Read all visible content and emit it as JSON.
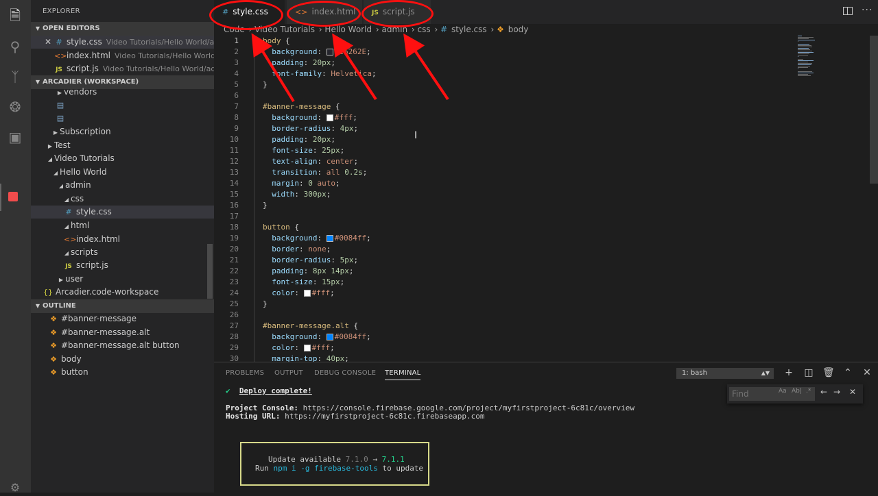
{
  "sidebar": {
    "title": "EXPLORER",
    "open_editors": {
      "header": "OPEN EDITORS",
      "items": [
        {
          "name": "style.css",
          "path": "Video Tutorials/Hello World/ad...",
          "icon": "css-file-icon"
        },
        {
          "name": "index.html",
          "path": "Video Tutorials/Hello World/a...",
          "icon": "html-file-icon"
        },
        {
          "name": "script.js",
          "path": "Video Tutorials/Hello World/adm...",
          "icon": "js-file-icon"
        }
      ]
    },
    "workspace": {
      "header": "ARCADIER (WORKSPACE)",
      "tree": [
        {
          "label": "vendors"
        },
        {
          "label": ""
        },
        {
          "label": ""
        },
        {
          "label": "Subscription"
        },
        {
          "label": "Test"
        },
        {
          "label": "Video Tutorials"
        },
        {
          "label": "Hello World"
        },
        {
          "label": "admin"
        },
        {
          "label": "css"
        },
        {
          "label": "style.css"
        },
        {
          "label": "html"
        },
        {
          "label": "index.html"
        },
        {
          "label": "scripts"
        },
        {
          "label": "script.js"
        },
        {
          "label": "user"
        },
        {
          "label": "Arcadier.code-workspace"
        }
      ]
    },
    "outline": {
      "header": "OUTLINE",
      "items": [
        "#banner-message",
        "#banner-message.alt",
        "#banner-message.alt button",
        "body",
        "button"
      ]
    }
  },
  "tabs": [
    {
      "label": "style.css",
      "icon_text": "#"
    },
    {
      "label": "index.html",
      "icon_text": "<>"
    },
    {
      "label": "script.js",
      "icon_text": "JS"
    }
  ],
  "breadcrumb": [
    "Code",
    "Video Tutorials",
    "Hello World",
    "admin",
    "css",
    "style.css",
    "body"
  ],
  "editor": {
    "lines": [
      [
        [
          "sel",
          "body"
        ],
        [
          "pun",
          " {"
        ]
      ],
      [
        [
          "pun",
          "  "
        ],
        [
          "prop",
          "background"
        ],
        [
          "pun",
          ": "
        ],
        [
          "swatch",
          "#26262E"
        ],
        [
          "val",
          "#26262E"
        ],
        [
          "pun",
          ";"
        ]
      ],
      [
        [
          "pun",
          "  "
        ],
        [
          "prop",
          "padding"
        ],
        [
          "pun",
          ": "
        ],
        [
          "num",
          "20px"
        ],
        [
          "pun",
          ";"
        ]
      ],
      [
        [
          "pun",
          "  "
        ],
        [
          "prop",
          "font-family"
        ],
        [
          "pun",
          ": "
        ],
        [
          "val",
          "Helvetica"
        ],
        [
          "pun",
          ";"
        ]
      ],
      [
        [
          "pun",
          "}"
        ]
      ],
      [],
      [
        [
          "sel",
          "#banner-message"
        ],
        [
          "pun",
          " {"
        ]
      ],
      [
        [
          "pun",
          "  "
        ],
        [
          "prop",
          "background"
        ],
        [
          "pun",
          ": "
        ],
        [
          "swatch",
          "#ffffff"
        ],
        [
          "val",
          "#fff"
        ],
        [
          "pun",
          ";"
        ]
      ],
      [
        [
          "pun",
          "  "
        ],
        [
          "prop",
          "border-radius"
        ],
        [
          "pun",
          ": "
        ],
        [
          "num",
          "4px"
        ],
        [
          "pun",
          ";"
        ]
      ],
      [
        [
          "pun",
          "  "
        ],
        [
          "prop",
          "padding"
        ],
        [
          "pun",
          ": "
        ],
        [
          "num",
          "20px"
        ],
        [
          "pun",
          ";"
        ]
      ],
      [
        [
          "pun",
          "  "
        ],
        [
          "prop",
          "font-size"
        ],
        [
          "pun",
          ": "
        ],
        [
          "num",
          "25px"
        ],
        [
          "pun",
          ";"
        ]
      ],
      [
        [
          "pun",
          "  "
        ],
        [
          "prop",
          "text-align"
        ],
        [
          "pun",
          ": "
        ],
        [
          "val",
          "center"
        ],
        [
          "pun",
          ";"
        ]
      ],
      [
        [
          "pun",
          "  "
        ],
        [
          "prop",
          "transition"
        ],
        [
          "pun",
          ": "
        ],
        [
          "val",
          "all "
        ],
        [
          "num",
          "0.2s"
        ],
        [
          "pun",
          ";"
        ]
      ],
      [
        [
          "pun",
          "  "
        ],
        [
          "prop",
          "margin"
        ],
        [
          "pun",
          ": "
        ],
        [
          "num",
          "0 "
        ],
        [
          "val",
          "auto"
        ],
        [
          "pun",
          ";"
        ]
      ],
      [
        [
          "pun",
          "  "
        ],
        [
          "prop",
          "width"
        ],
        [
          "pun",
          ": "
        ],
        [
          "num",
          "300px"
        ],
        [
          "pun",
          ";"
        ]
      ],
      [
        [
          "pun",
          "}"
        ]
      ],
      [],
      [
        [
          "sel",
          "button"
        ],
        [
          "pun",
          " {"
        ]
      ],
      [
        [
          "pun",
          "  "
        ],
        [
          "prop",
          "background"
        ],
        [
          "pun",
          ": "
        ],
        [
          "swatch",
          "#0084ff"
        ],
        [
          "val",
          "#0084ff"
        ],
        [
          "pun",
          ";"
        ]
      ],
      [
        [
          "pun",
          "  "
        ],
        [
          "prop",
          "border"
        ],
        [
          "pun",
          ": "
        ],
        [
          "val",
          "none"
        ],
        [
          "pun",
          ";"
        ]
      ],
      [
        [
          "pun",
          "  "
        ],
        [
          "prop",
          "border-radius"
        ],
        [
          "pun",
          ": "
        ],
        [
          "num",
          "5px"
        ],
        [
          "pun",
          ";"
        ]
      ],
      [
        [
          "pun",
          "  "
        ],
        [
          "prop",
          "padding"
        ],
        [
          "pun",
          ": "
        ],
        [
          "num",
          "8px 14px"
        ],
        [
          "pun",
          ";"
        ]
      ],
      [
        [
          "pun",
          "  "
        ],
        [
          "prop",
          "font-size"
        ],
        [
          "pun",
          ": "
        ],
        [
          "num",
          "15px"
        ],
        [
          "pun",
          ";"
        ]
      ],
      [
        [
          "pun",
          "  "
        ],
        [
          "prop",
          "color"
        ],
        [
          "pun",
          ": "
        ],
        [
          "swatch",
          "#ffffff"
        ],
        [
          "val",
          "#fff"
        ],
        [
          "pun",
          ";"
        ]
      ],
      [
        [
          "pun",
          "}"
        ]
      ],
      [],
      [
        [
          "sel",
          "#banner-message.alt"
        ],
        [
          "pun",
          " {"
        ]
      ],
      [
        [
          "pun",
          "  "
        ],
        [
          "prop",
          "background"
        ],
        [
          "pun",
          ": "
        ],
        [
          "swatch",
          "#0084ff"
        ],
        [
          "val",
          "#0084ff"
        ],
        [
          "pun",
          ";"
        ]
      ],
      [
        [
          "pun",
          "  "
        ],
        [
          "prop",
          "color"
        ],
        [
          "pun",
          ": "
        ],
        [
          "swatch",
          "#ffffff"
        ],
        [
          "val",
          "#fff"
        ],
        [
          "pun",
          ";"
        ]
      ],
      [
        [
          "pun",
          "  "
        ],
        [
          "prop",
          "margin-top"
        ],
        [
          "pun",
          ": "
        ],
        [
          "num",
          "40px"
        ],
        [
          "pun",
          ";"
        ]
      ]
    ]
  },
  "panel": {
    "tabs": [
      "PROBLEMS",
      "OUTPUT",
      "DEBUG CONSOLE",
      "TERMINAL"
    ],
    "terminal_select": "1: bash",
    "find_placeholder": "Find",
    "find_options": [
      "Aa",
      "Ab|",
      ".*"
    ],
    "terminal": {
      "check": "✔",
      "deploy": "Deploy complete!",
      "console_label": "Project Console:",
      "console_url": "https://console.firebase.google.com/project/myfirstproject-6c81c/overview",
      "hosting_label": "Hosting URL:",
      "hosting_url": "https://myfirstproject-6c81c.firebaseapp.com",
      "update_text": "Update available",
      "from_version": "7.1.0",
      "arrow": "→",
      "to_version": "7.1.1",
      "run_text": "Run",
      "command": "npm i -g firebase-tools",
      "to_update": "to update"
    }
  },
  "colors": {
    "annotation": "#ff1010",
    "accent_blue": "#0084ff"
  }
}
